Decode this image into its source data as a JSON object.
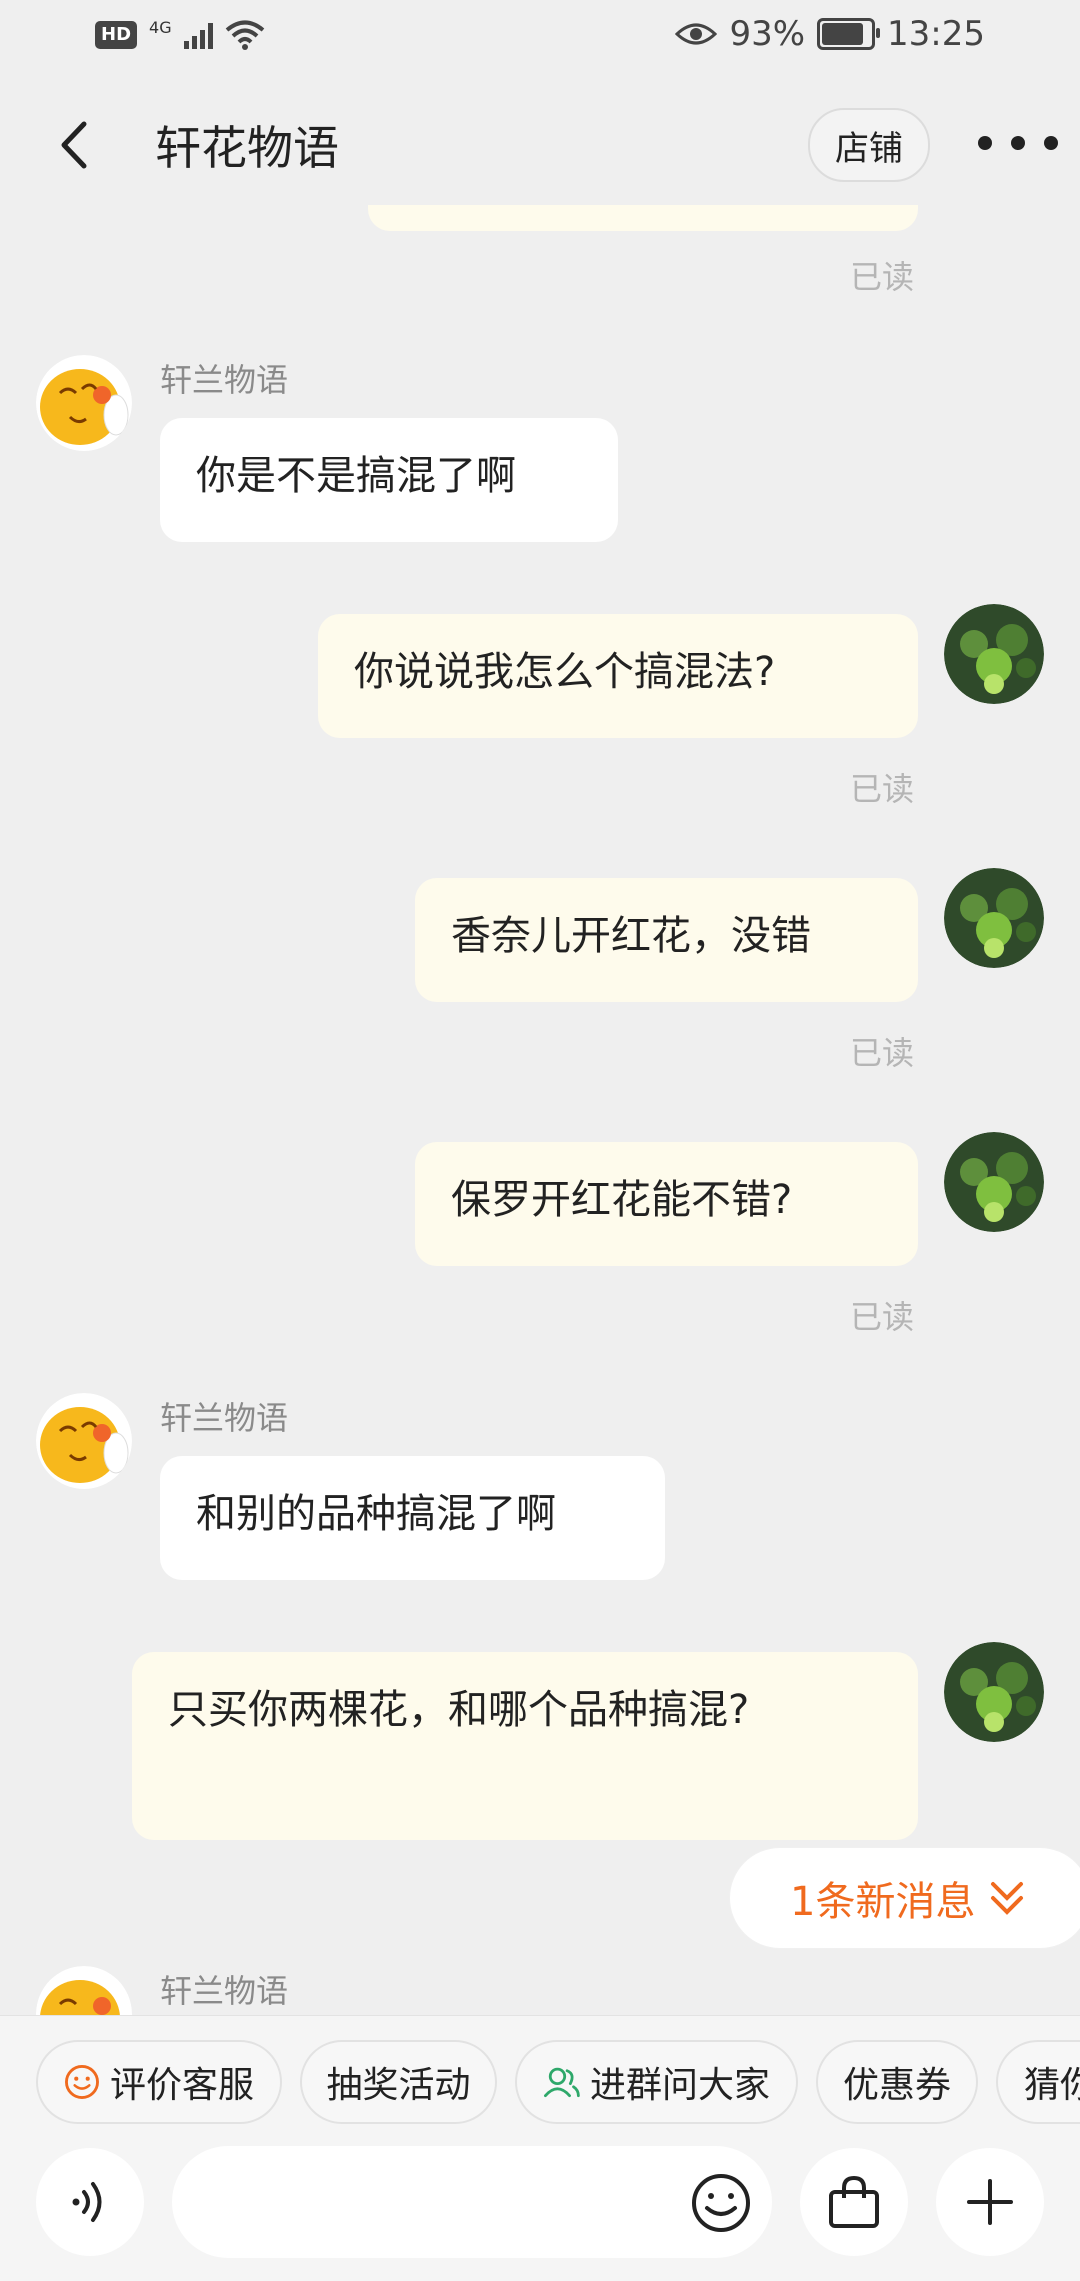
{
  "status_bar": {
    "hd": "HD",
    "network": "4G",
    "battery": "93%",
    "battery_level": 0.93,
    "time": "13:25"
  },
  "header": {
    "title": "轩花物语",
    "shop_button": "店铺"
  },
  "messages": {
    "m0_read": "已读",
    "m1_sender": "轩兰物语",
    "m1_text": "你是不是搞混了啊",
    "m2_text": "你说说我怎么个搞混法?",
    "m2_read": "已读",
    "m3_text": "香奈儿开红花，没错",
    "m3_read": "已读",
    "m4_text": "保罗开红花能不错?",
    "m4_read": "已读",
    "m5_sender": "轩兰物语",
    "m5_text": "和别的品种搞混了啊",
    "m6_text": "只买你两棵花，和哪个品种搞混?",
    "m7_sender": "轩兰物语"
  },
  "new_messages": "1条新消息",
  "quick_actions": [
    "评价客服",
    "抽奖活动",
    "进群问大家",
    "优惠券",
    "猜你"
  ],
  "icons": {
    "back": "back-arrow-icon",
    "more": "more-dots-icon",
    "voice": "voice-icon",
    "emoji": "emoji-icon",
    "bag": "shopping-bag-icon",
    "plus": "plus-icon"
  },
  "colors": {
    "accent": "#f06a1e",
    "bubble_self": "#fefbec",
    "bubble_other": "#ffffff",
    "background": "#efefef"
  }
}
